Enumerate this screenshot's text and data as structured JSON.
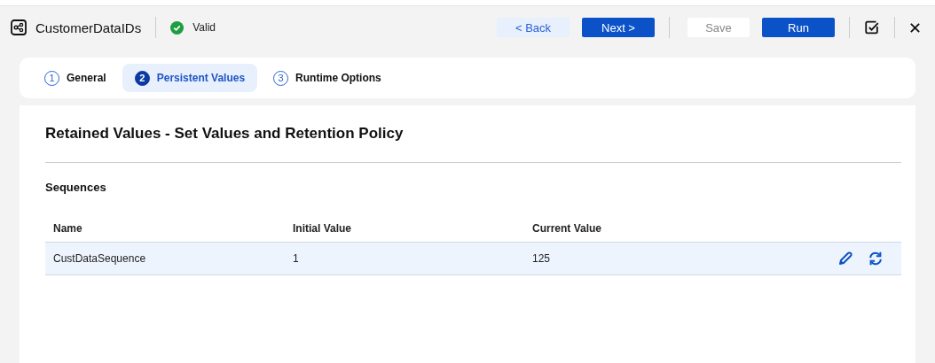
{
  "header": {
    "title": "CustomerDataIDs",
    "status": "Valid",
    "valid": true
  },
  "toolbar": {
    "buttons": [
      {
        "label": "< Back",
        "kind": "secondary",
        "disabled": false
      },
      {
        "label": "Next >",
        "kind": "primary",
        "disabled": false
      },
      {
        "label": "Save",
        "kind": "plain",
        "disabled": true
      },
      {
        "label": "Run",
        "kind": "primary",
        "disabled": false
      }
    ]
  },
  "tabs": [
    {
      "number": "1",
      "label": "General",
      "selected": false
    },
    {
      "number": "2",
      "label": "Persistent Values",
      "selected": true
    },
    {
      "number": "3",
      "label": "Runtime Options",
      "selected": false
    }
  ],
  "section": {
    "title": "Retained Values - Set Values and Retention Policy",
    "subtitle": "Sequences"
  },
  "table": {
    "columns": [
      "Name",
      "Initial Value",
      "Current Value"
    ],
    "rows": [
      {
        "cells": [
          "CustDataSequence",
          "1",
          "125"
        ],
        "selected": true
      }
    ]
  }
}
